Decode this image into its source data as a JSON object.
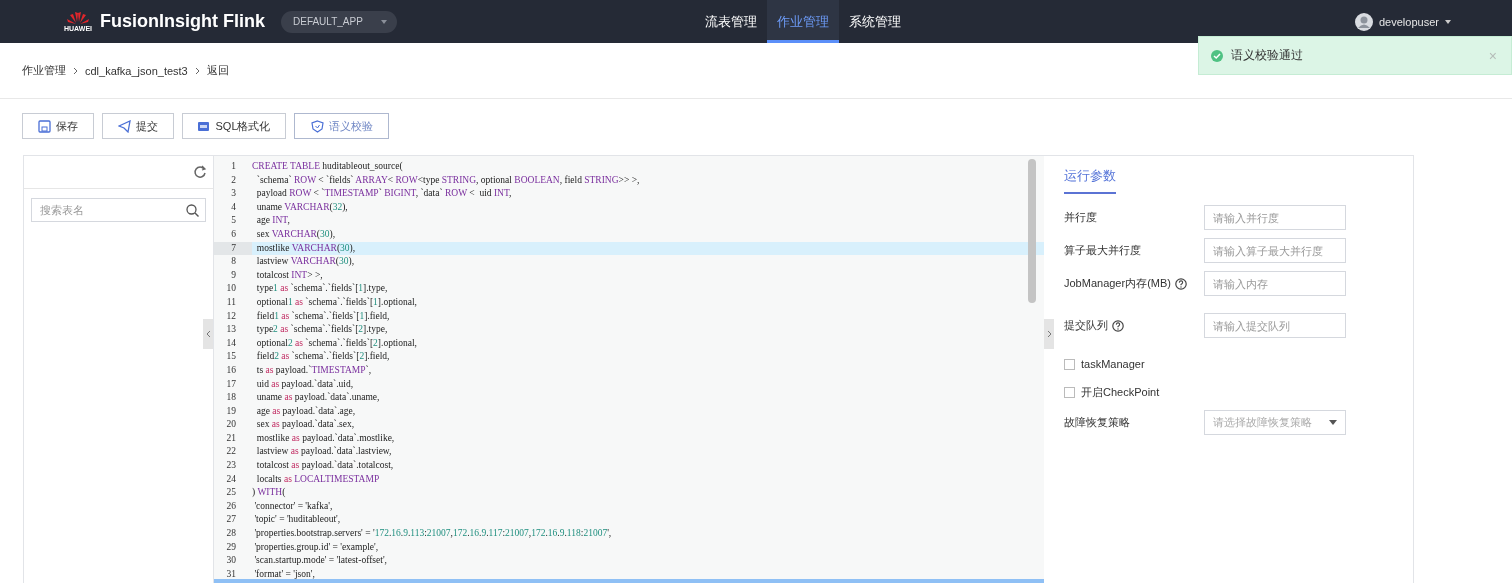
{
  "header": {
    "logo_text": "HUAWEI",
    "brand": "FusionInsight Flink",
    "app_selector": "DEFAULT_APP",
    "nav": [
      {
        "label": "流表管理",
        "selected": false
      },
      {
        "label": "作业管理",
        "selected": true
      },
      {
        "label": "系统管理",
        "selected": false
      }
    ],
    "user": "developuser"
  },
  "toast": {
    "message": "语义校验通过",
    "close": "×"
  },
  "breadcrumb": [
    "作业管理",
    "cdl_kafka_json_test3",
    "返回"
  ],
  "toolbar": [
    {
      "kind": "save",
      "label": "保存"
    },
    {
      "kind": "submit",
      "label": "提交"
    },
    {
      "kind": "format",
      "label": "SQL格式化"
    },
    {
      "kind": "check",
      "label": "语义校验"
    }
  ],
  "table_panel": {
    "search": {
      "placeholder": "搜索表名"
    }
  },
  "editor": {
    "lines": [
      {
        "n": "1",
        "code": "CREATE TABLE huditableout_source(",
        "active": false
      },
      {
        "n": "2",
        "code": "  `schema` ROW < `fields` ARRAY< ROW<type STRING, optional BOOLEAN, field STRING>> >,",
        "active": false
      },
      {
        "n": "3",
        "code": "  payload ROW < `TIMESTAMP` BIGINT, `data` ROW <  uid INT,",
        "active": false
      },
      {
        "n": "4",
        "code": "  uname VARCHAR(32),",
        "active": false
      },
      {
        "n": "5",
        "code": "  age INT,",
        "active": false
      },
      {
        "n": "6",
        "code": "  sex VARCHAR(30),",
        "active": false
      },
      {
        "n": "7",
        "code": "  mostlike VARCHAR(30),",
        "active": true
      },
      {
        "n": "8",
        "code": "  lastview VARCHAR(30),",
        "active": false
      },
      {
        "n": "9",
        "code": "  totalcost INT> >,",
        "active": false
      },
      {
        "n": "10",
        "code": "  type1 as `schema`.`fields`[1].type,",
        "active": false
      },
      {
        "n": "11",
        "code": "  optional1 as `schema`.`fields`[1].optional,",
        "active": false
      },
      {
        "n": "12",
        "code": "  field1 as `schema`.`fields`[1].field,",
        "active": false
      },
      {
        "n": "13",
        "code": "  type2 as `schema`.`fields`[2].type,",
        "active": false
      },
      {
        "n": "14",
        "code": "  optional2 as `schema`.`fields`[2].optional,",
        "active": false
      },
      {
        "n": "15",
        "code": "  field2 as `schema`.`fields`[2].field,",
        "active": false
      },
      {
        "n": "16",
        "code": "  ts as payload.`TIMESTAMP`,",
        "active": false
      },
      {
        "n": "17",
        "code": "  uid as payload.`data`.uid,",
        "active": false
      },
      {
        "n": "18",
        "code": "  uname as payload.`data`.uname,",
        "active": false
      },
      {
        "n": "19",
        "code": "  age as payload.`data`.age,",
        "active": false
      },
      {
        "n": "20",
        "code": "  sex as payload.`data`.sex,",
        "active": false
      },
      {
        "n": "21",
        "code": "  mostlike as payload.`data`.mostlike,",
        "active": false
      },
      {
        "n": "22",
        "code": "  lastview as payload.`data`.lastview,",
        "active": false
      },
      {
        "n": "23",
        "code": "  totalcost as payload.`data`.totalcost,",
        "active": false
      },
      {
        "n": "24",
        "code": "  localts as LOCALTIMESTAMP",
        "active": false
      },
      {
        "n": "25",
        "code": ") WITH(",
        "active": false
      },
      {
        "n": "26",
        "code": " 'connector' = 'kafka',",
        "active": false
      },
      {
        "n": "27",
        "code": " 'topic' = 'huditableout',",
        "active": false
      },
      {
        "n": "28",
        "code": " 'properties.bootstrap.servers' = '172.16.9.113:21007,172.16.9.117:21007,172.16.9.118:21007',",
        "active": false
      },
      {
        "n": "29",
        "code": " 'properties.group.id' = 'example',",
        "active": false
      },
      {
        "n": "30",
        "code": " 'scan.startup.mode' = 'latest-offset',",
        "active": false
      },
      {
        "n": "31",
        "code": " 'format' = 'json',",
        "active": false
      }
    ]
  },
  "params": {
    "tab": {
      "label": "运行参数",
      "selected": true
    },
    "items": [
      {
        "kind": "input",
        "label": "并行度",
        "placeholder": "请输入并行度",
        "help": false
      },
      {
        "kind": "input",
        "label": "算子最大并行度",
        "placeholder": "请输入算子最大并行度",
        "help": false
      },
      {
        "kind": "input",
        "label": "JobManager内存(MB)",
        "placeholder": "请输入内存",
        "help": true
      },
      {
        "kind": "input",
        "label": "提交队列",
        "placeholder": "请输入提交队列",
        "help": true
      },
      {
        "kind": "checkbox",
        "label": "taskManager",
        "checked": false
      },
      {
        "kind": "checkbox",
        "label": "开启CheckPoint",
        "checked": false
      },
      {
        "kind": "select",
        "label": "故障恢复策略",
        "placeholder": "请选择故障恢复策略"
      }
    ]
  }
}
